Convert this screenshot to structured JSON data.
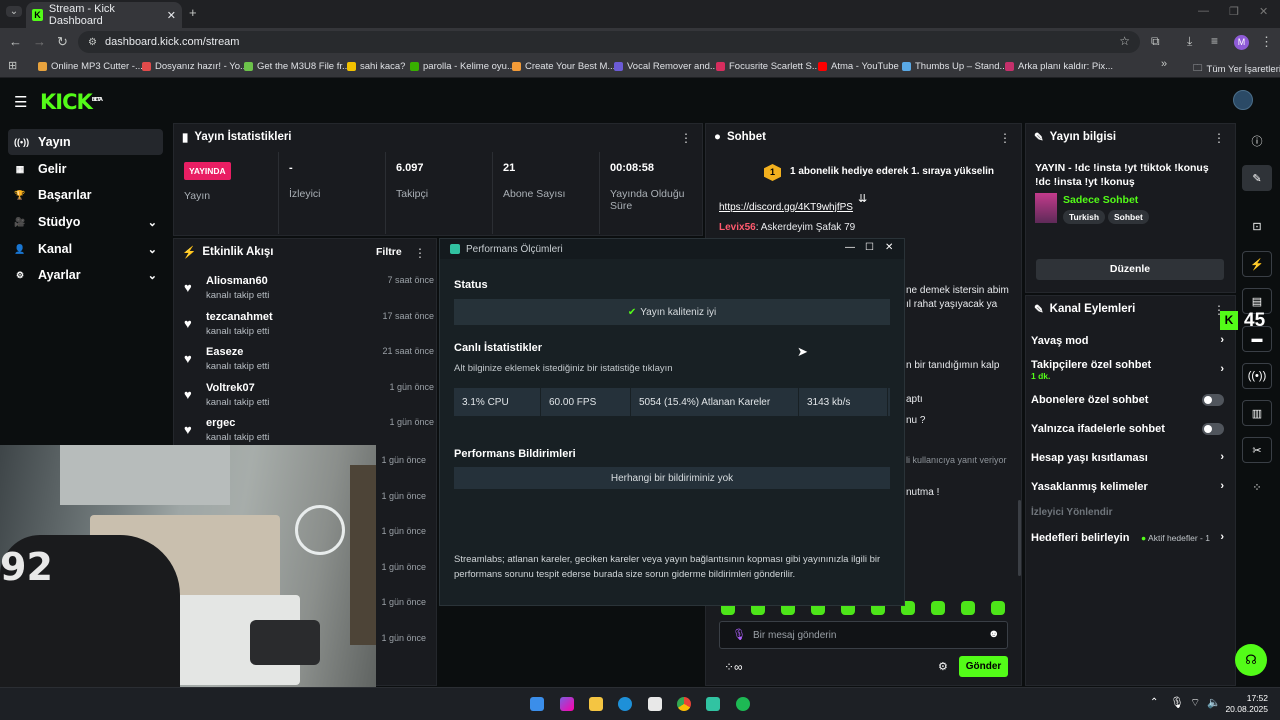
{
  "browser": {
    "tab_title": "Stream - Kick Dashboard",
    "url": "dashboard.kick.com/stream",
    "profile_letter": "M",
    "bookmarks": [
      {
        "label": "Online MP3 Cutter -...",
        "color": "#e8a33d"
      },
      {
        "label": "Dosyanız hazır! - Yo...",
        "color": "#e24b4b"
      },
      {
        "label": "Get the M3U8 File fr...",
        "color": "#6cc24a"
      },
      {
        "label": "sahi kaca?",
        "color": "#f2c200"
      },
      {
        "label": "parolla - Kelime oyu...",
        "color": "#38b000"
      },
      {
        "label": "Create Your Best M...",
        "color": "#f29b38"
      },
      {
        "label": "Vocal Remover and...",
        "color": "#6b5bd6"
      },
      {
        "label": "Focusrite Scarlett S...",
        "color": "#d62d5e"
      },
      {
        "label": "Atma - YouTube",
        "color": "#ff0000"
      },
      {
        "label": "Thumbs Up – Stand...",
        "color": "#5aa9e6"
      },
      {
        "label": "Arka planı kaldır: Pix...",
        "color": "#c5306b"
      }
    ],
    "all_bookmarks": "Tüm Yer İşaretleri"
  },
  "kick": {
    "logo": "KICK",
    "logo_sup": "BETA",
    "nav": [
      {
        "label": "Yayın",
        "icon": "live-icon",
        "glyph": "((•))",
        "active": true
      },
      {
        "label": "Gelir",
        "icon": "money-icon",
        "glyph": "▦"
      },
      {
        "label": "Başarılar",
        "icon": "trophy-icon",
        "glyph": "🏆"
      },
      {
        "label": "Stüdyo",
        "icon": "studio-icon",
        "glyph": "🎥"
      },
      {
        "label": "Kanal",
        "icon": "channel-icon",
        "glyph": "👤"
      },
      {
        "label": "Ayarlar",
        "icon": "settings-icon",
        "glyph": "⚙"
      }
    ]
  },
  "stats": {
    "title": "Yayın İstatistikleri",
    "live_badge": "YAYINDA",
    "live_label": "Yayın",
    "viewers_value": "-",
    "viewers_label": "İzleyici",
    "followers_value": "6.097",
    "followers_label": "Takipçi",
    "subs_value": "21",
    "subs_label": "Abone Sayısı",
    "uptime_value": "00:08:58",
    "uptime_label": "Yayında Olduğu Süre"
  },
  "activity": {
    "title": "Etkinlik Akışı",
    "filter": "Filtre",
    "events": [
      {
        "name": "Aliosman60",
        "action": "kanalı takip etti",
        "time": "7 saat önce"
      },
      {
        "name": "tezcanahmet",
        "action": "kanalı takip etti",
        "time": "17 saat önce"
      },
      {
        "name": "Easeze",
        "action": "kanalı takip etti",
        "time": "21 saat önce"
      },
      {
        "name": "Voltrek07",
        "action": "kanalı takip etti",
        "time": "1 gün önce"
      },
      {
        "name": "ergec",
        "action": "kanalı takip etti",
        "time": "1 gün önce"
      }
    ],
    "more_times": [
      "1 gün önce",
      "1 gün önce",
      "1 gün önce",
      "1 gün önce",
      "1 gün önce",
      "1 gün önce"
    ]
  },
  "modal": {
    "title": "Performans Ölçümleri",
    "status_heading": "Status",
    "status_text": "Yayın kaliteniz iyi",
    "live_heading": "Canlı İstatistikler",
    "live_sub": "Alt bilginize eklemek istediğiniz bir istatistiğe tıklayın",
    "cpu": "3.1% CPU",
    "fps": "60.00 FPS",
    "dropped": "5054 (15.4%) Atlanan Kareler",
    "bitrate": "3143 kb/s",
    "notif_heading": "Performans Bildirimleri",
    "notif_empty": "Herhangi bir bildiriminiz yok",
    "footer": "Streamlabs; atlanan kareler, geciken kareler veya yayın bağlantısının kopması gibi yayınınızla ilgili bir performans sorunu tespit ederse burada size sorun giderme bildirimleri gönderilir."
  },
  "chat": {
    "title": "Sohbet",
    "promo_badge": "1",
    "promo": "1 abonelik hediye ederek 1. sıraya yükselin",
    "link": "https://discord.gg/4KT9whjfPS",
    "user": "Levix56",
    "user_msg": ": Askerdeyim Şafak 79",
    "frag1": "ne demek istersin abim",
    "frag2": "ıl rahat yaşıyacak ya",
    "frag3": "n bir tanıdığımın kalp",
    "frag4": "aptı",
    "frag5": "nu ?",
    "frag6": "li kullanıcıya yanıt veriyor",
    "frag7": "nutma !",
    "input_placeholder": "Bir mesaj gönderin",
    "send": "Gönder"
  },
  "info": {
    "title": "Yayın bilgisi",
    "stream_title": "YAYIN - !dc !insta !yt !tiktok !konuş !dc !insta !yt !konuş",
    "category": "Sadece Sohbet",
    "tags": [
      "Turkish",
      "Sohbet"
    ],
    "edit": "Düzenle"
  },
  "actions": {
    "title": "Kanal Eylemleri",
    "slow": "Yavaş mod",
    "followers": "Takipçilere özel sohbet",
    "followers_sub": "1 dk.",
    "subs": "Abonelere özel sohbet",
    "emotes": "Yalnızca ifadelerle sohbet",
    "age": "Hesap yaşı kısıtlaması",
    "banned": "Yasaklanmış kelimeler",
    "section": "İzleyici Yönlendir",
    "goals": "Hedefleri belirleyin",
    "goals_sub": "Aktif hedefler - 1"
  },
  "overlay_count": "45",
  "clock": {
    "time": "17:52",
    "date": "20.08.2025"
  },
  "colors": {
    "accent": "#53fc18",
    "live": "#e91e63",
    "panel": "#191b1f"
  }
}
